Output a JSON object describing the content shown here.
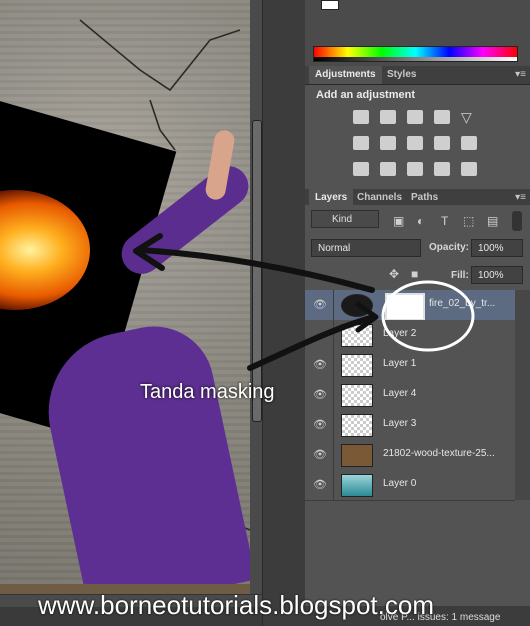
{
  "adjustments_panel": {
    "tabs": [
      "Adjustments",
      "Styles"
    ],
    "title": "Add an adjustment"
  },
  "layers_panel": {
    "tabs": [
      "Layers",
      "Channels",
      "Paths"
    ],
    "kind_filter": "Kind",
    "blend_mode": "Normal",
    "opacity_label": "Opacity:",
    "opacity_value": "100%",
    "fill_label": "Fill:",
    "fill_value": "100%",
    "layers": [
      {
        "name": "fire_02_by_tr...",
        "selected": true,
        "thumb": "fire"
      },
      {
        "name": "Layer 2",
        "selected": false,
        "thumb": "transparent"
      },
      {
        "name": "Layer 1",
        "selected": false,
        "thumb": "transparent"
      },
      {
        "name": "Layer 4",
        "selected": false,
        "thumb": "transparent"
      },
      {
        "name": "Layer 3",
        "selected": false,
        "thumb": "transparent"
      },
      {
        "name": "21802-wood-texture-25...",
        "selected": false,
        "thumb": "wood"
      },
      {
        "name": "Layer 0",
        "selected": false,
        "thumb": "water"
      }
    ]
  },
  "annotation": {
    "label": "Tanda masking"
  },
  "status_bar": {
    "text": "olve P... issues: 1 message"
  },
  "watermark": "www.borneotutorials.blogspot.com"
}
